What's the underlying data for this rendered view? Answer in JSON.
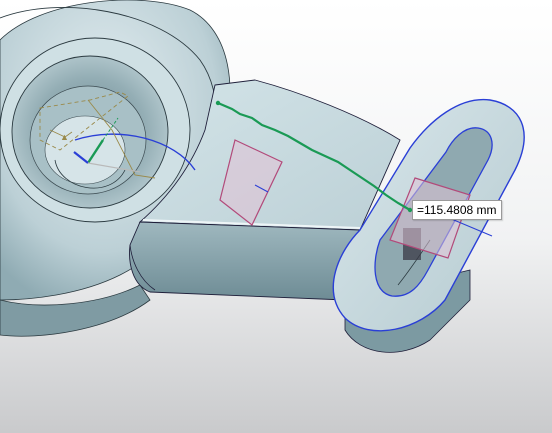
{
  "viewport": {
    "background_top": "#ffffff",
    "background_bottom": "#c8c9cb",
    "part_color": "#c9dadf",
    "part_shadow": "#7d9aa2",
    "edge_color": "#1f1f3a",
    "selected_edge_color": "#2a3fd6",
    "measure_line_color": "#1a9a55",
    "face_marker_color": "#b24a7a",
    "csys_color": "#9a8a4a"
  },
  "measurement": {
    "value": "=115.4808 mm"
  }
}
